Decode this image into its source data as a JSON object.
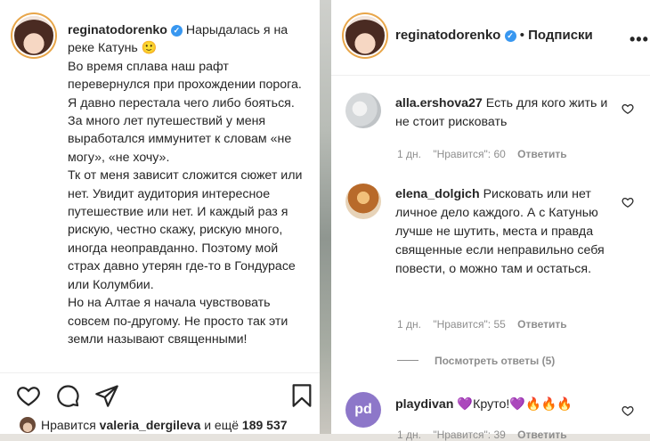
{
  "left": {
    "username": "reginatodorenko",
    "caption_paragraphs": [
      "Нарыдалась я на реке Катунь 🙂",
      "Во время сплава наш рафт перевернулся при прохождении порога. Я давно перестала чего либо бояться. За много лет путешествий у меня выработался иммунитет к словам «не могу», «не хочу».",
      "Тк от меня зависит сложится сюжет или нет. Увидит аудитория интересное путешествие или нет. И каждый раз я рискую, честно скажу, рискую много, иногда неоправданно. Поэтому мой страх давно утерян где-то в Гондурасе или Колумбии.",
      "Но на Алтае я начала чувствовать совсем по-другому. Не просто так эти земли называют священными!"
    ],
    "likes": {
      "prefix": "Нравится",
      "user": "valeria_dergileva",
      "middle": "и ещё",
      "count": "189 537"
    },
    "icons": [
      "heart-icon",
      "comment-icon",
      "share-icon",
      "bookmark-icon"
    ]
  },
  "right": {
    "header": {
      "username": "reginatodorenko",
      "separator": "•",
      "follow_label": "Подписки",
      "more": "•••"
    },
    "comments": [
      {
        "user": "alla.ershova27",
        "text": "Есть для кого жить и не стоит рисковать",
        "age": "1 дн.",
        "likes": "\"Нравится\": 60",
        "reply": "Ответить"
      },
      {
        "user": "elena_dolgich",
        "text": "Рисковать или нет личное дело каждого. А с Катунью лучше не шутить, места и правда священные если неправильно себя повести, о можно там и остаться.",
        "age": "1 дн.",
        "likes": "\"Нравится\": 55",
        "reply": "Ответить",
        "view_replies": "Посмотреть ответы (5)"
      },
      {
        "user": "playdivan",
        "text_prefix": "💜",
        "text": "Круто!",
        "text_suffix_heart": "💜",
        "text_suffix_fire": "🔥🔥🔥",
        "age": "1 дн.",
        "likes": "\"Нравится\": 39",
        "reply": "Ответить",
        "avatar_initials": "pd"
      }
    ]
  },
  "colors": {
    "verified": "#3897f0",
    "text": "#262626",
    "meta": "#8e8e8e",
    "playdivan_avatar": "#8d77c9"
  }
}
